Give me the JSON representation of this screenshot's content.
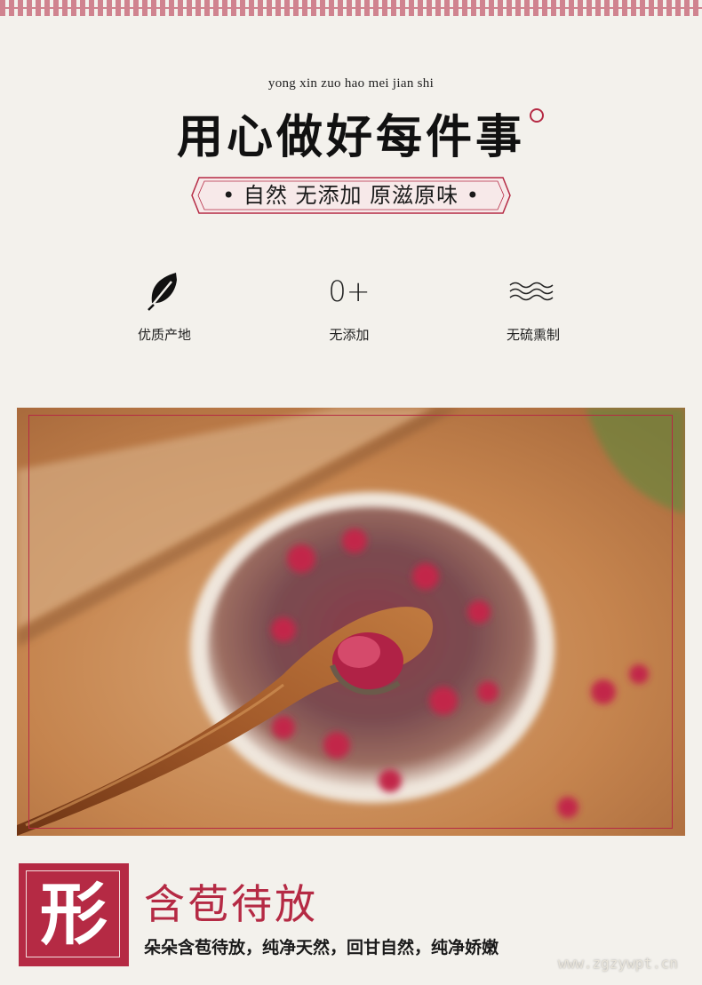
{
  "header": {
    "pinyin": "yong xin zuo hao mei jian shi",
    "headline": "用心做好每件事",
    "banner_text": "• 自然 无添加 原滋原味 •"
  },
  "features": [
    {
      "icon": "leaf-icon",
      "label": "优质产地"
    },
    {
      "icon_text": "0+",
      "label": "无添加"
    },
    {
      "icon": "wave-icon",
      "label": "无硫熏制"
    }
  ],
  "section": {
    "badge": "形",
    "title": "含苞待放",
    "description": "朵朵含苞待放，纯净天然，回甘自然，纯净娇嫩"
  },
  "watermark": "www.zgzywpt.cn",
  "colors": {
    "accent": "#b52a44",
    "background": "#f3f1ec"
  }
}
